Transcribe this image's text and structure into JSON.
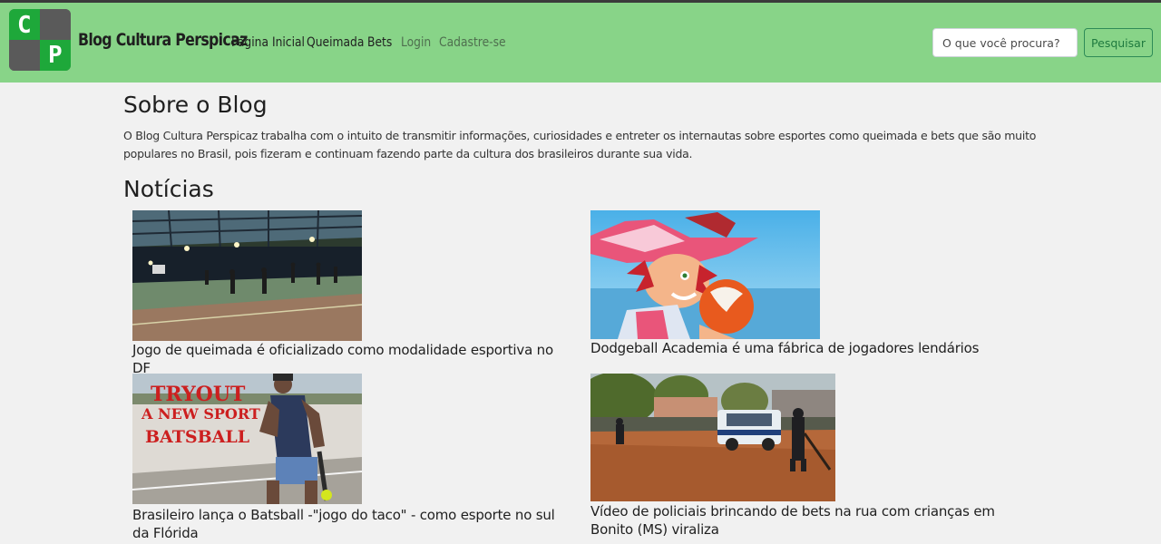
{
  "header": {
    "brand": "Blog Cultura Perspicaz",
    "logo_letters": [
      "C",
      "P"
    ],
    "nav": [
      {
        "label": "Página Inicial",
        "active": true
      },
      {
        "label": "Queimada",
        "active": true
      },
      {
        "label": "Bets",
        "active": true
      },
      {
        "label": "Login",
        "active": false
      },
      {
        "label": "Cadastre-se",
        "active": false
      }
    ],
    "search": {
      "placeholder": "O que você procura?",
      "button_label": "Pesquisar"
    }
  },
  "about": {
    "title": "Sobre o Blog",
    "text": "O Blog Cultura Perspicaz trabalha com o intuito de transmitir informações, curiosidades e entreter os internautas sobre esportes como queimada e bets que são muito populares no Brasil, pois fizeram e continuam fazendo parte da cultura dos brasileiros durante sua vida."
  },
  "news": {
    "title": "Notícias",
    "items": [
      {
        "caption": "Jogo de queimada é oficializado como modalidade esportiva no DF",
        "image": "indoor-court-photo"
      },
      {
        "caption": "Dodgeball Academia é uma fábrica de jogadores lendários",
        "image": "cartoon-dodgeball-player"
      },
      {
        "caption": "Brasileiro lança o Batsball -\"jogo do taco\" - como esporte no sul da Flórida",
        "image": "batsball-tryout-photo",
        "overlay_lines": [
          "TRYOUT",
          "A NEW SPORT",
          "BATSBALL"
        ]
      },
      {
        "caption": "Vídeo de policiais brincando de bets na rua com crianças em Bonito (MS) viraliza",
        "image": "police-playing-bets-photo"
      }
    ]
  },
  "colors": {
    "navbar": "#88d488",
    "page": "#f1f1f1",
    "accent": "#1ea83a"
  }
}
